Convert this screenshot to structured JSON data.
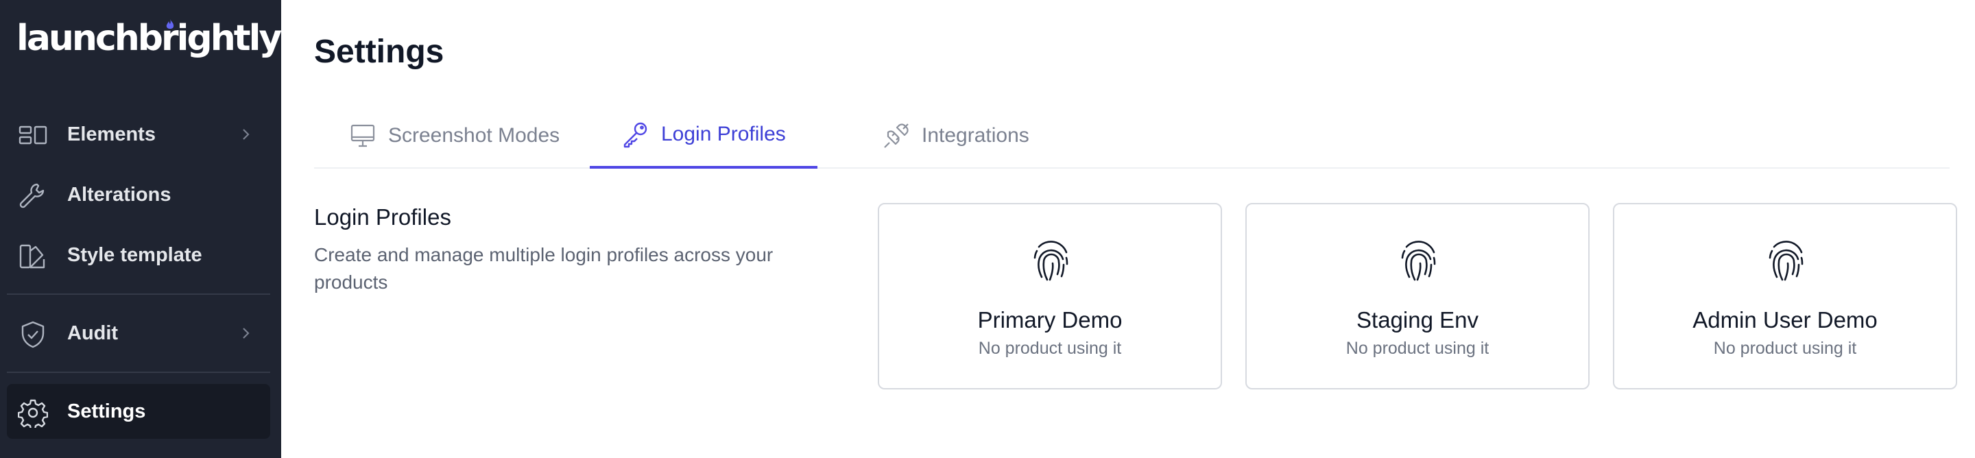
{
  "brand": {
    "logo_text": "launchbrightly",
    "accent": "#4f46e5"
  },
  "sidebar": {
    "items": [
      {
        "label": "Elements",
        "icon": "elements-icon",
        "has_chevron": true
      },
      {
        "label": "Alterations",
        "icon": "wrench-icon",
        "has_chevron": false
      },
      {
        "label": "Style template",
        "icon": "style-template-icon",
        "has_chevron": false
      },
      {
        "label": "Audit",
        "icon": "shield-check-icon",
        "has_chevron": true
      },
      {
        "label": "Settings",
        "icon": "gear-icon",
        "has_chevron": false,
        "active": true
      }
    ]
  },
  "header": {
    "title": "Settings"
  },
  "tabs": [
    {
      "label": "Screenshot Modes",
      "icon": "monitor-icon",
      "active": false
    },
    {
      "label": "Login Profiles",
      "icon": "key-icon",
      "active": true
    },
    {
      "label": "Integrations",
      "icon": "plug-icon",
      "active": false
    }
  ],
  "section": {
    "title": "Login Profiles",
    "description": "Create and manage multiple login profiles across your products"
  },
  "profiles": [
    {
      "name": "Primary Demo",
      "status": "No product using it",
      "icon": "fingerprint-icon"
    },
    {
      "name": "Staging Env",
      "status": "No product using it",
      "icon": "fingerprint-icon"
    },
    {
      "name": "Admin User Demo",
      "status": "No product using it",
      "icon": "fingerprint-icon"
    }
  ]
}
